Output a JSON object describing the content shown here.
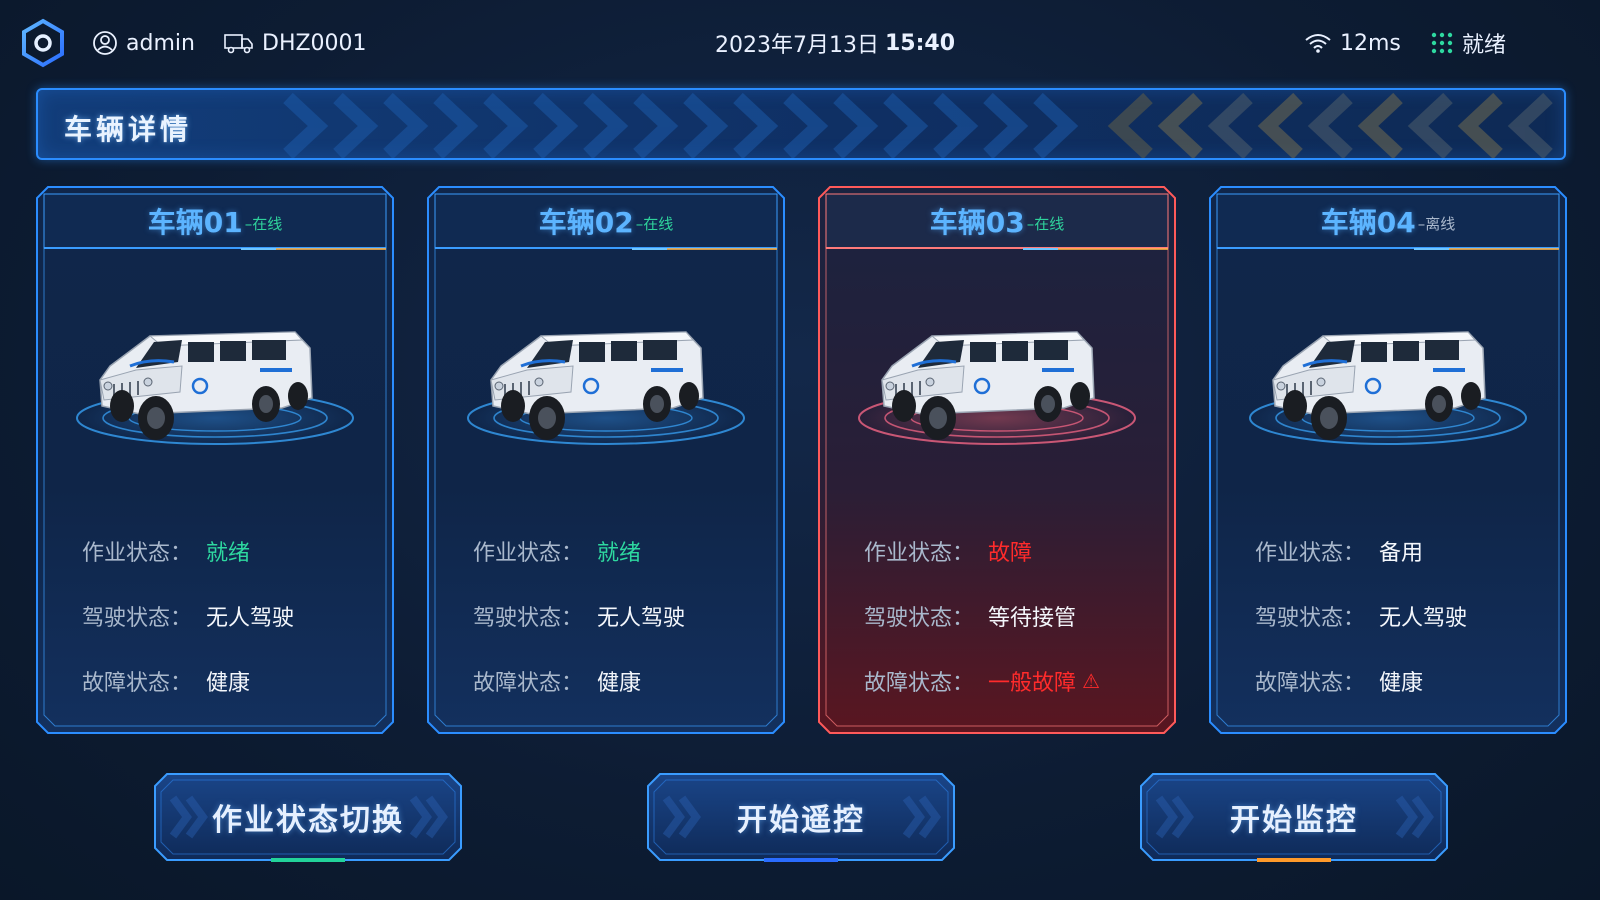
{
  "topbar": {
    "user": "admin",
    "device_id": "DHZ0001",
    "date": "2023年7月13日",
    "time": "15:40",
    "latency": "12ms",
    "system_status": "就绪"
  },
  "section": {
    "title": "车辆详情"
  },
  "labels": {
    "work_status": "作业状态：",
    "drive_status": "驾驶状态：",
    "fault_status": "故障状态："
  },
  "vehicles": [
    {
      "name": "车辆01",
      "online": "–在线",
      "work": "就绪",
      "drive": "无人驾驶",
      "fault": "健康"
    },
    {
      "name": "车辆02",
      "online": "–在线",
      "work": "就绪",
      "drive": "无人驾驶",
      "fault": "健康"
    },
    {
      "name": "车辆03",
      "online": "–在线",
      "work": "故障",
      "drive": "等待接管",
      "fault": "一般故障"
    },
    {
      "name": "车辆04",
      "online": "–离线",
      "work": "备用",
      "drive": "无人驾驶",
      "fault": "健康"
    }
  ],
  "buttons": {
    "switch_mode": "作业状态切换",
    "start_remote": "开始遥控",
    "start_monitor": "开始监控"
  },
  "colors": {
    "accent_blue": "#2b8dff",
    "ok_green": "#2ed9a0",
    "fault_red": "#ff2b2b",
    "btn_green": "#22d39a",
    "btn_blue": "#2a6cff",
    "btn_orange": "#ff9a2a"
  },
  "icons": {
    "logo": "hexagon-ring-icon",
    "user": "user-circle-icon",
    "device": "truck-icon",
    "network": "wifi-icon",
    "status": "grid-dots-icon",
    "warning": "warning-triangle-icon"
  }
}
